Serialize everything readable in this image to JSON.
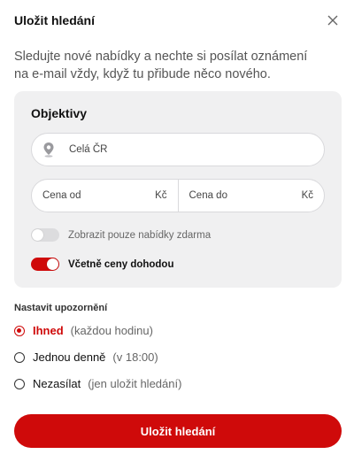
{
  "modal": {
    "title": "Uložit hledání",
    "close_icon": "close-icon",
    "description": "Sledujte nové nabídky a nechte si posílat oznámení na e-mail vždy, když tu přibude něco nového."
  },
  "filters": {
    "title": "Objektivy",
    "location": {
      "icon": "location-pin-icon",
      "value": "Celá ČR"
    },
    "price_from": {
      "placeholder": "Cena od",
      "currency": "Kč"
    },
    "price_to": {
      "placeholder": "Cena do",
      "currency": "Kč"
    },
    "free_only": {
      "label": "Zobrazit pouze nabídky zdarma",
      "enabled": false
    },
    "negotiable": {
      "label": "Včetně ceny dohodou",
      "enabled": true
    }
  },
  "notifications": {
    "title": "Nastavit upozornění",
    "options": [
      {
        "label": "Ihned",
        "hint": "(každou hodinu)",
        "selected": true
      },
      {
        "label": "Jednou denně",
        "hint": "(v 18:00)",
        "selected": false
      },
      {
        "label": "Nezasílat",
        "hint": "(jen uložit hledání)",
        "selected": false
      }
    ]
  },
  "submit_label": "Uložit hledání",
  "colors": {
    "accent": "#cf0a0a",
    "panel": "#f0f0f1"
  }
}
